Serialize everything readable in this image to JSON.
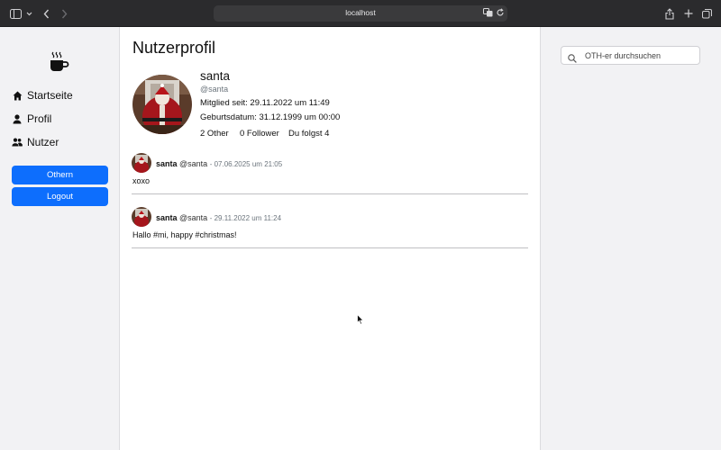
{
  "browser": {
    "url": "localhost"
  },
  "sidebar": {
    "items": [
      {
        "label": "Startseite",
        "icon": "home-icon"
      },
      {
        "label": "Profil",
        "icon": "person-icon"
      },
      {
        "label": "Nutzer",
        "icon": "people-icon"
      }
    ],
    "primary_button": "Othern",
    "logout_button": "Logout"
  },
  "profile": {
    "page_title": "Nutzerprofil",
    "name": "santa",
    "handle": "@santa",
    "member_since": "Mitglied seit: 29.11.2022 um 11:49",
    "birthdate": "Geburtsdatum: 31.12.1999 um 00:00",
    "others": "2 Other",
    "followers": "0 Follower",
    "following": "Du folgst 4"
  },
  "posts": [
    {
      "name": "santa",
      "handle": "@santa",
      "date": "- 07.06.2025 um 21:05",
      "text": "xoxo"
    },
    {
      "name": "santa",
      "handle": "@santa",
      "date": "- 29.11.2022 um 11:24",
      "text": "Hallo #mi, happy #christmas!"
    }
  ],
  "search": {
    "placeholder": "OTH-er durchsuchen"
  },
  "colors": {
    "primary": "#0d6efd",
    "chrome": "#2b2b2d"
  }
}
